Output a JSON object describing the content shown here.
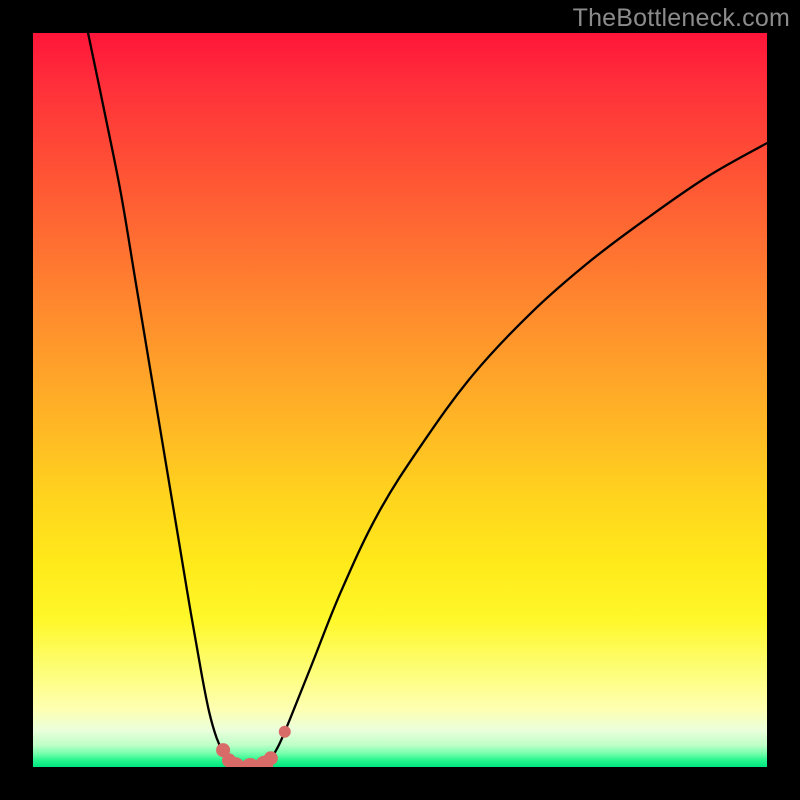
{
  "watermark": "TheBottleneck.com",
  "colors": {
    "frame": "#000000",
    "curve": "#000000",
    "marker_fill": "#d86a67",
    "marker_stroke": "#c95652"
  },
  "chart_data": {
    "type": "line",
    "title": "",
    "xlabel": "",
    "ylabel": "",
    "xlim": [
      0,
      100
    ],
    "ylim": [
      0,
      100
    ],
    "grid": false,
    "legend": false,
    "series": [
      {
        "name": "left-branch",
        "x": [
          7.5,
          10,
          12,
          14,
          16,
          18,
          20,
          21.5,
          23,
          24,
          25,
          26,
          27,
          27.5
        ],
        "y": [
          100,
          88,
          78,
          66,
          54,
          42,
          30,
          21,
          12.5,
          7.5,
          4,
          1.8,
          0.4,
          0
        ]
      },
      {
        "name": "trough",
        "x": [
          27.5,
          28.5,
          29.6,
          30.5,
          31.5
        ],
        "y": [
          0,
          0,
          0,
          0,
          0
        ]
      },
      {
        "name": "right-branch",
        "x": [
          31.5,
          32.2,
          33.5,
          35,
          38,
          42,
          47,
          53,
          60,
          68,
          76,
          84,
          92,
          100
        ],
        "y": [
          0,
          0.8,
          3,
          6.5,
          14,
          24,
          34.5,
          44,
          53.5,
          62,
          69,
          75,
          80.5,
          85
        ]
      }
    ],
    "markers": [
      {
        "x": 25.9,
        "y": 2.3,
        "r": 7
      },
      {
        "x": 26.7,
        "y": 0.9,
        "r": 7
      },
      {
        "x": 27.6,
        "y": 0.1,
        "r": 9
      },
      {
        "x": 29.6,
        "y": 0.0,
        "r": 9
      },
      {
        "x": 31.5,
        "y": 0.3,
        "r": 9
      },
      {
        "x": 32.4,
        "y": 1.2,
        "r": 7
      },
      {
        "x": 34.3,
        "y": 4.8,
        "r": 6
      }
    ]
  }
}
